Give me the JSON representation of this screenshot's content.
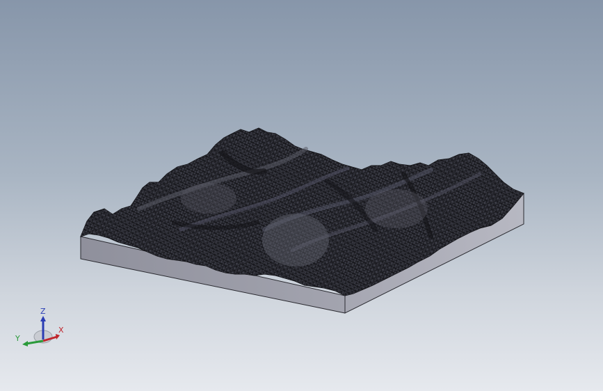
{
  "viewport": {
    "background_top": "#8796aa",
    "background_bottom": "#e6e9ee"
  },
  "model": {
    "base_side_color": "#8b8c97",
    "base_front_color": "#9c9da8",
    "base_top_color": "#7e808c",
    "mesh_color": "#1a1a1f",
    "terrain_color": "#3a3b44"
  },
  "triad": {
    "x_label": "X",
    "y_label": "Y",
    "z_label": "Z",
    "x_color": "#c0262d",
    "y_color": "#2a9a3a",
    "z_color": "#2a3cb4"
  }
}
